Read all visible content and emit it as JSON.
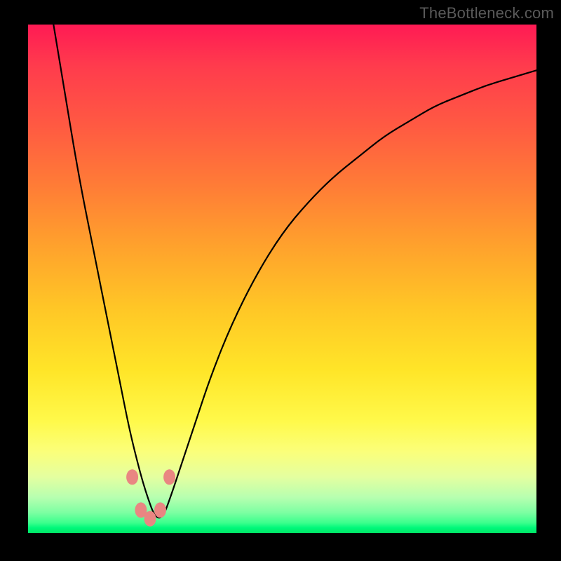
{
  "attribution_text": "TheBottleneck.com",
  "colors": {
    "frame": "#000000",
    "curve": "#000000",
    "dot": "#e98682",
    "gradient_top": "#ff1a54",
    "gradient_bottom": "#00e766"
  },
  "chart_data": {
    "type": "line",
    "title": "",
    "xlabel": "",
    "ylabel": "",
    "xlim": [
      0,
      100
    ],
    "ylim": [
      0,
      100
    ],
    "note": "No axes or tick labels shown. Curve values estimated from pixel position; y=0 at bottom (green), y=100 at top (red). Minimum sits near x≈24.",
    "series": [
      {
        "name": "bottleneck-curve",
        "x": [
          5,
          7,
          10,
          13,
          16,
          18,
          20,
          22,
          23.5,
          25,
          26.5,
          28,
          30,
          33,
          36,
          40,
          45,
          50,
          55,
          60,
          65,
          70,
          75,
          80,
          85,
          90,
          95,
          100
        ],
        "y": [
          100,
          88,
          70,
          55,
          40,
          30,
          20,
          12,
          7,
          3,
          3,
          7,
          13,
          22,
          31,
          41,
          51,
          59,
          65,
          70,
          74,
          78,
          81,
          84,
          86,
          88,
          89.5,
          91
        ]
      }
    ],
    "markers": [
      {
        "x": 20.5,
        "y": 11
      },
      {
        "x": 22.2,
        "y": 4.5
      },
      {
        "x": 24.0,
        "y": 2.8
      },
      {
        "x": 26.0,
        "y": 4.5
      },
      {
        "x": 27.8,
        "y": 11
      }
    ]
  }
}
